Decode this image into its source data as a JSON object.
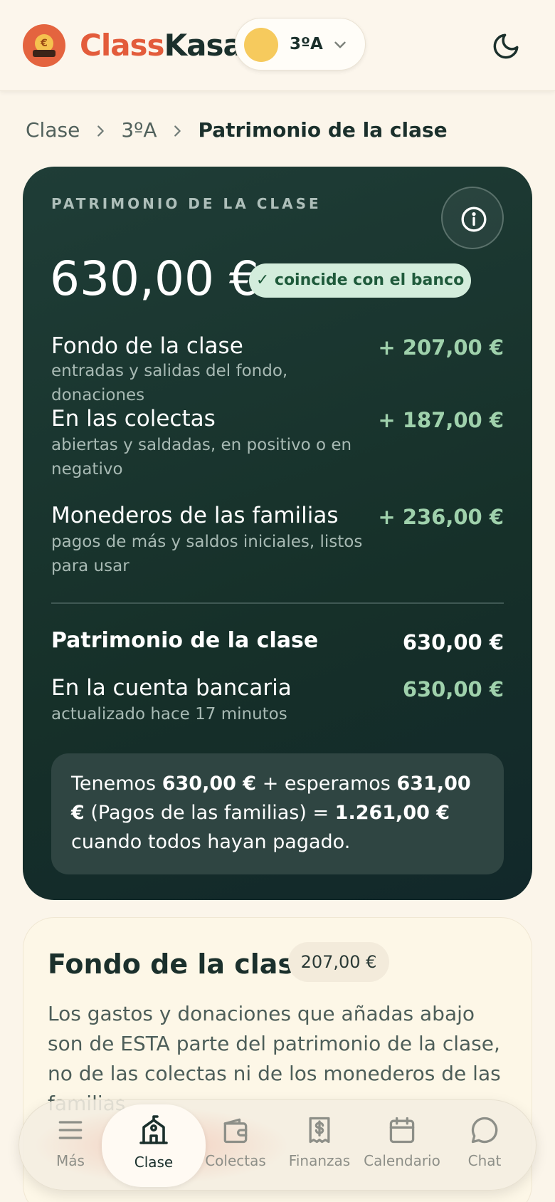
{
  "header": {
    "brand_part1": "Class",
    "brand_part2": "Kasa",
    "class_selector": "3ºA"
  },
  "breadcrumb": {
    "items": [
      "Clase",
      "3ºA"
    ],
    "current": "Patrimonio de la clase"
  },
  "wealth_card": {
    "kicker": "PATRIMONIO DE LA CLASE",
    "total": "630,00 €",
    "badge": "✓ coincide con el banco",
    "rows": [
      {
        "title": "Fondo de la clase",
        "subtitle": "entradas y salidas del fondo, donaciones",
        "value": "+ 207,00 €"
      },
      {
        "title": "En las colectas",
        "subtitle": "abiertas y saldadas, en positivo o en negativo",
        "value": "+ 187,00 €"
      },
      {
        "title": "Monederos de las familias",
        "subtitle": "pagos de más y saldos iniciales, listos para usar",
        "value": "+ 236,00 €"
      }
    ],
    "total_row": {
      "title": "Patrimonio de la clase",
      "value": "630,00 €"
    },
    "bank_row": {
      "title": "En la cuenta bancaria",
      "subtitle": "actualizado hace 17 minutos",
      "value": "630,00 €"
    },
    "summary": {
      "t1": "Tenemos ",
      "v1": "630,00 €",
      "t2": " + esperamos ",
      "v2": "631,00 €",
      "t3": " (Pagos de las familias) = ",
      "v3": "1.261,00 €",
      "t4": " cuando todos hayan pagado."
    }
  },
  "fund_card": {
    "title": "Fondo de la clase",
    "amount": "207,00 €",
    "description": "Los gastos y donaciones que añadas abajo son de ESTA parte del patrimonio de la clase, no de las colectas ni de los monederos de las familias."
  },
  "bottom_nav": {
    "items": [
      "Más",
      "Clase",
      "Colectas",
      "Finanzas",
      "Calendario",
      "Chat"
    ],
    "active": "Clase"
  },
  "colors": {
    "accent": "#e35c3b",
    "dark_card": "#1a342f",
    "positive": "#9fd1ac",
    "background": "#fbf5ea"
  }
}
